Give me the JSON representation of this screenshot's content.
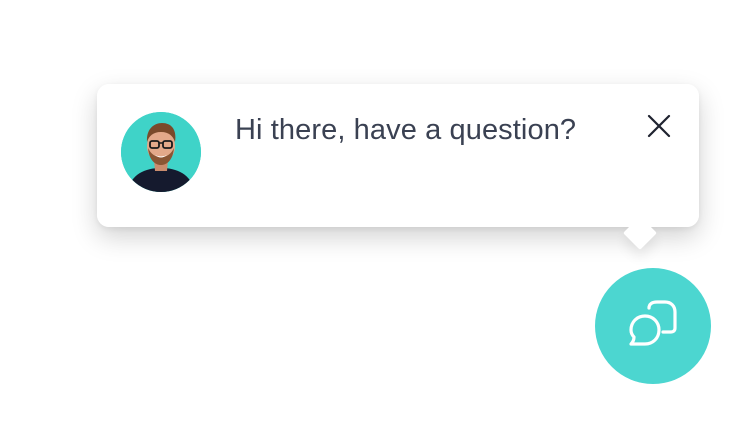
{
  "popup": {
    "message": "Hi there, have a question?",
    "avatar_bg": "#3fd3c8"
  },
  "icons": {
    "close": "close-icon",
    "chat": "chat-bubbles-icon"
  },
  "colors": {
    "accent": "#4cd6d0",
    "text": "#3a4152"
  }
}
